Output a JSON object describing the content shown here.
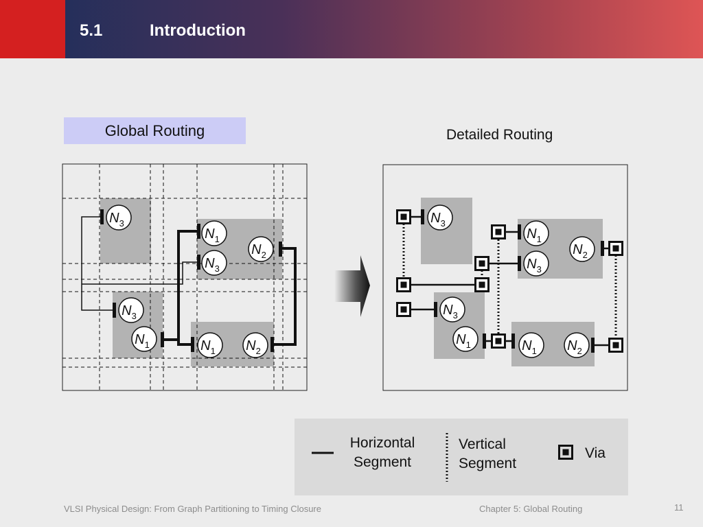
{
  "header": {
    "section_number": "5.1",
    "section_title": "Introduction"
  },
  "global_routing": {
    "title": "Global Routing",
    "pins": {
      "n3_top": {
        "name": "N",
        "sub": "3"
      },
      "n1_top": {
        "name": "N",
        "sub": "1"
      },
      "n2_top": {
        "name": "N",
        "sub": "2"
      },
      "n3_mid": {
        "name": "N",
        "sub": "3"
      },
      "n3_left": {
        "name": "N",
        "sub": "3"
      },
      "n1_left": {
        "name": "N",
        "sub": "1"
      },
      "n1_bottom": {
        "name": "N",
        "sub": "1"
      },
      "n2_bottom": {
        "name": "N",
        "sub": "2"
      }
    }
  },
  "detailed_routing": {
    "title": "Detailed Routing",
    "pins": {
      "n3_top": {
        "name": "N",
        "sub": "3"
      },
      "n1_top": {
        "name": "N",
        "sub": "1"
      },
      "n2_top": {
        "name": "N",
        "sub": "2"
      },
      "n3_mid": {
        "name": "N",
        "sub": "3"
      },
      "n3_left": {
        "name": "N",
        "sub": "3"
      },
      "n1_left": {
        "name": "N",
        "sub": "1"
      },
      "n1_bottom": {
        "name": "N",
        "sub": "1"
      },
      "n2_bottom": {
        "name": "N",
        "sub": "2"
      }
    }
  },
  "legend": {
    "horizontal": "Horizontal\nSegment",
    "vertical": "Vertical\nSegment",
    "via": "Via"
  },
  "footer": {
    "book": "VLSI Physical Design: From Graph Partitioning to Timing Closure",
    "chapter": "Chapter 5: Global Routing",
    "page": "11"
  },
  "colors": {
    "cell_fill": "#b3b3b3",
    "label_box": "#ccccf6",
    "legend_bg": "#dadada"
  }
}
